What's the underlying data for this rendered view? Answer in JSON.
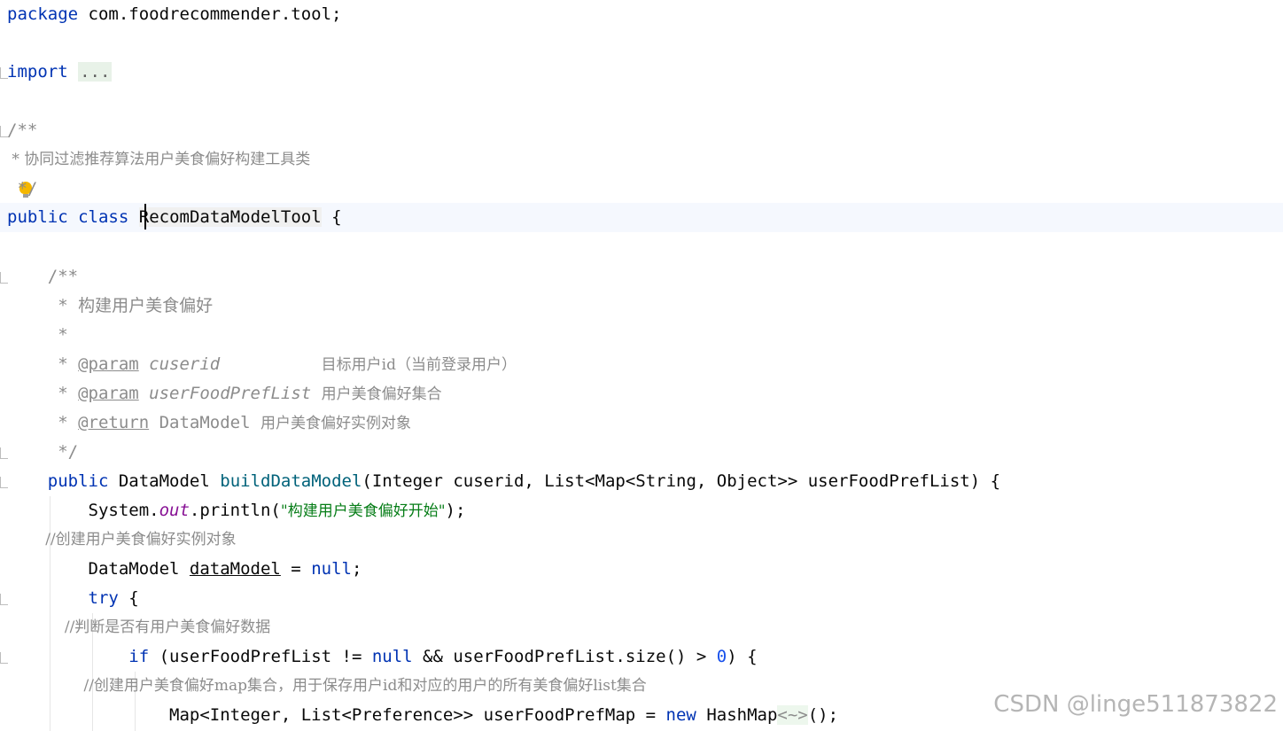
{
  "code": {
    "l1": {
      "kw": "package",
      "rest": " com.foodrecommender.tool;"
    },
    "l2": {
      "kw": "import",
      "fold": "..."
    },
    "l3": {
      "text": "/**"
    },
    "l4": {
      "text": " * 协同过滤推荐算法用户美食偏好构建工具类"
    },
    "l5": {
      "text": " */"
    },
    "l6": {
      "kw1": "public",
      "kw2": "class",
      "name": "RecomDataModelTool",
      "rest": " {"
    },
    "l7": {
      "text": "    /**"
    },
    "l8": {
      "text": "     * 构建用户美食偏好"
    },
    "l9": {
      "text": "     *"
    },
    "l10": {
      "star": "     * ",
      "tag": "@param",
      "pname": "cuserid",
      "pad": "          ",
      "desc": "目标用户id（当前登录用户）"
    },
    "l11": {
      "star": "     * ",
      "tag": "@param",
      "pname": "userFoodPrefList",
      "desc": "用户美食偏好集合"
    },
    "l12": {
      "star": "     * ",
      "tag": "@return",
      "type": "DataModel",
      "desc": "用户美食偏好实例对象"
    },
    "l13": {
      "text": "     */"
    },
    "l14": {
      "indent": "    ",
      "kw": "public",
      "type": " DataModel ",
      "fn": "buildDataModel",
      "rest": "(Integer cuserid, List<Map<String, Object>> userFoodPrefList) {"
    },
    "l15": {
      "indent": "        ",
      "pre": "System.",
      "field": "out",
      "mid": ".println(",
      "str": "\"构建用户美食偏好开始\"",
      "post": ");"
    },
    "l16": {
      "text": "        //创建用户美食偏好实例对象"
    },
    "l17": {
      "indent": "        ",
      "pre": "DataModel ",
      "var": "dataModel",
      "mid": " = ",
      "kw": "null",
      "post": ";"
    },
    "l18": {
      "indent": "        ",
      "kw": "try",
      "post": " {"
    },
    "l19": {
      "text": "            //判断是否有用户美食偏好数据"
    },
    "l20": {
      "indent": "            ",
      "kw": "if",
      "a": " (userFoodPrefList != ",
      "kwnull": "null",
      "b": " && userFoodPrefList.size() > ",
      "num": "0",
      "c": ") {"
    },
    "l21": {
      "text": "                //创建用户美食偏好map集合，用于保存用户id和对应的用户的所有美食偏好list集合"
    },
    "l22": {
      "indent": "                ",
      "pre": "Map<Integer, List<Preference>> userFoodPrefMap = ",
      "kw": "new",
      "mid": " HashMap",
      "diamond": "<~>",
      "post": "();"
    }
  },
  "watermark": "CSDN @linge511873822"
}
